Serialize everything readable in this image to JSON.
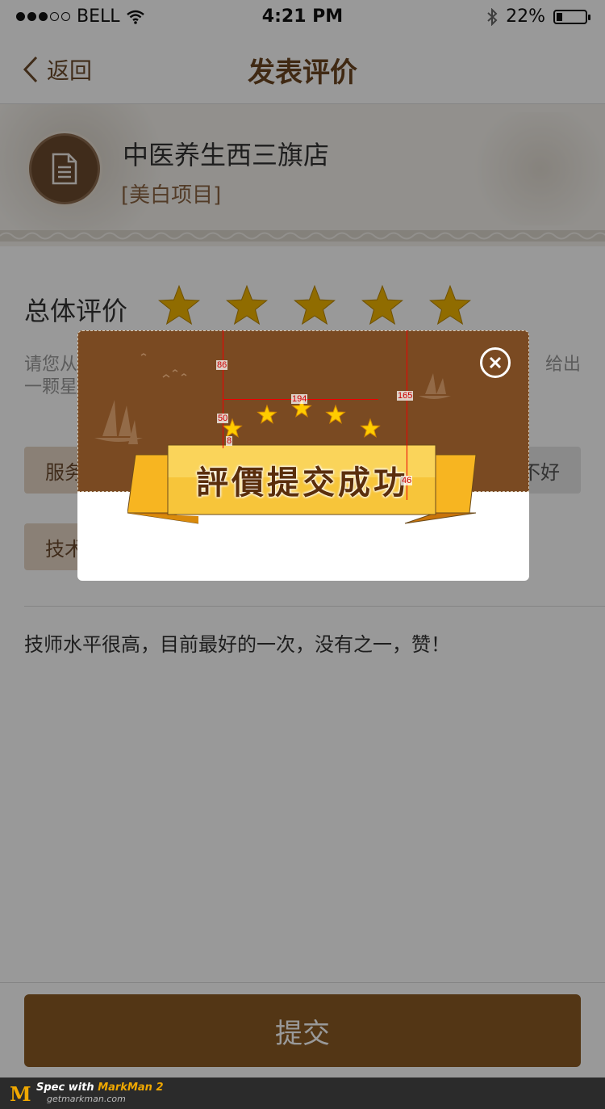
{
  "status_bar": {
    "carrier": "BELL",
    "time": "4:21 PM",
    "battery": "22%",
    "battery_level": 0.22,
    "signal_filled": 3,
    "signal_total": 5
  },
  "nav": {
    "back_label": "返回",
    "title": "发表评价"
  },
  "store": {
    "name": "中医养生西三旗店",
    "tag": "[美白项目]"
  },
  "rating": {
    "label": "总体评价",
    "stars": 5,
    "star_color": "#f0b400"
  },
  "hint": {
    "line1": "请您从",
    "line2": "一颗星",
    "right": "给出"
  },
  "chips": {
    "service": "服务",
    "tech": "技术",
    "bad": "不好"
  },
  "comment": "技师水平很高，目前最好的一次，没有之一，赞！",
  "submit_label": "提交",
  "modal": {
    "title": "評價提交成功",
    "stars": 5,
    "colors": {
      "top": "#7a4a22",
      "ribbon": "#f7b521",
      "ribbon_dark": "#e08e0b"
    },
    "measurements": {
      "m1": "86",
      "m2": "194",
      "m3": "165",
      "m4": "50",
      "m5": "8",
      "m6": "46"
    }
  },
  "markman": {
    "text_prefix": "Spec with ",
    "brand": "MarkMan 2",
    "url": "getmarkman.com"
  }
}
